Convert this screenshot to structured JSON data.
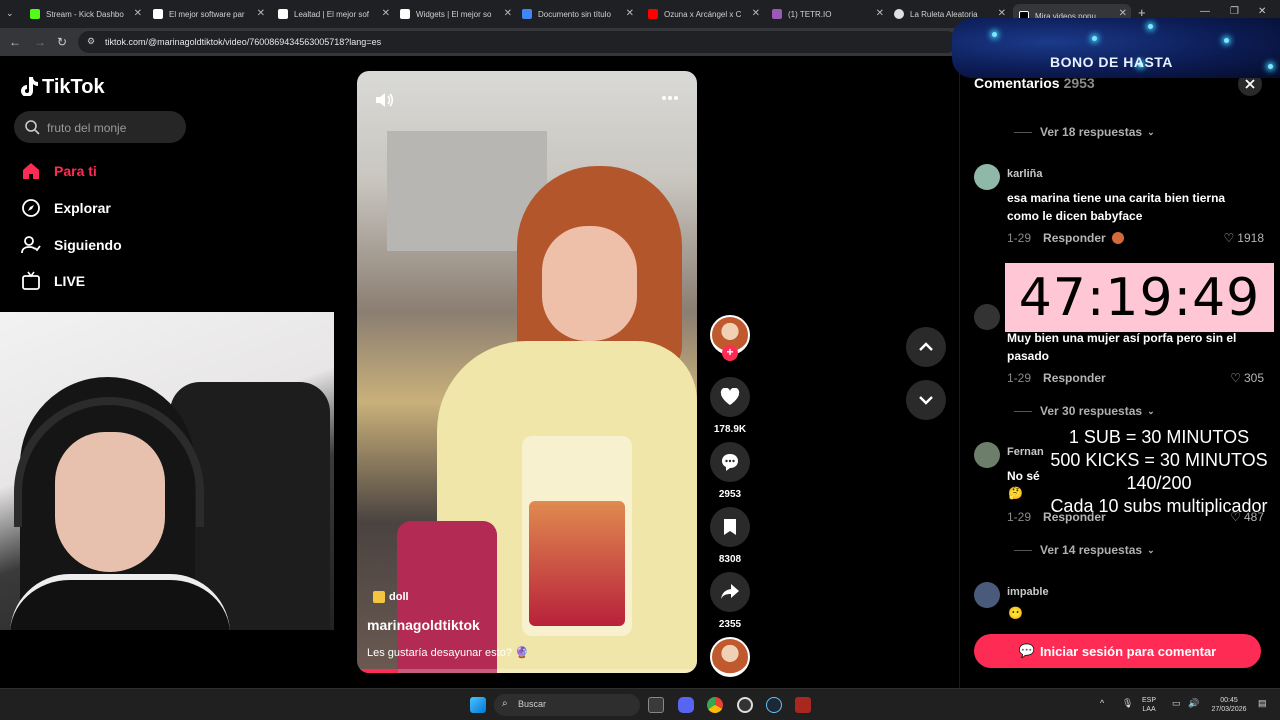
{
  "browser": {
    "tabs": [
      {
        "title": "Stream - Kick Dashbo",
        "color": "#53fc18"
      },
      {
        "title": "El mejor software par",
        "color": "#ffffff"
      },
      {
        "title": "Lealtad | El mejor sof",
        "color": "#ffffff"
      },
      {
        "title": "Widgets | El mejor so",
        "color": "#ffffff"
      },
      {
        "title": "Documento sin título",
        "color": "#4285f4"
      },
      {
        "title": "Ozuna x Arcángel x C",
        "color": "#ff0000"
      },
      {
        "title": "(1) TETR.IO",
        "color": "#9b59b6"
      },
      {
        "title": "La Ruleta Aleatoria",
        "color": "#e0e0e0"
      },
      {
        "title": "Mira videos popu",
        "color": "#ffffff"
      }
    ],
    "url": "tiktok.com/@marinagoldtiktok/video/7600869434563005718?lang=es"
  },
  "sidebar": {
    "logo": "TikTok",
    "search_placeholder": "fruto del monje",
    "nav": [
      {
        "label": "Para ti",
        "icon": "home-icon",
        "active": true
      },
      {
        "label": "Explorar",
        "icon": "compass-icon",
        "active": false
      },
      {
        "label": "Siguiendo",
        "icon": "user-follow-icon",
        "active": false
      },
      {
        "label": "LIVE",
        "icon": "live-tv-icon",
        "active": false
      }
    ]
  },
  "video": {
    "music": "doll",
    "author": "marinagoldtiktok",
    "caption": "Les gustaría desayunar esto? 🔮",
    "progress_fraction": 0.12
  },
  "actions": {
    "likes": "178.9K",
    "comments": "2953",
    "saves": "8308",
    "shares": "2355"
  },
  "comments": {
    "title": "Comentarios",
    "count": "2953",
    "items": [
      {
        "type": "replies",
        "label": "Ver 18 respuestas"
      },
      {
        "type": "comment",
        "user": "karliña",
        "text": "esa marina tiene una carita bien tierna como le dicen babyface",
        "date": "1-29",
        "reply": "Responder",
        "likes": "1918"
      },
      {
        "type": "comment",
        "user": "",
        "text": "Muy bien una mujer así porfa pero sin el pasado",
        "date": "1-29",
        "reply": "Responder",
        "likes": "305"
      },
      {
        "type": "replies",
        "label": "Ver 30 respuestas"
      },
      {
        "type": "comment",
        "user": "Fernan",
        "text": "No sé",
        "date": "1-29",
        "reply": "Responder",
        "likes": "487"
      },
      {
        "type": "replies",
        "label": "Ver 14 respuestas"
      },
      {
        "type": "comment",
        "user": "impable",
        "text": "",
        "date": "",
        "reply": "",
        "likes": ""
      }
    ],
    "login_button": "Iniciar sesión para comentar"
  },
  "overlay": {
    "bonus_text": "BONO DE HASTA",
    "timer": "47:19:49",
    "rules": [
      "1 SUB     = 30 MINUTOS",
      "500 KICKS = 30 MINUTOS",
      "140/200",
      "Cada 10 subs multiplicador"
    ]
  },
  "taskbar": {
    "search_label": "Buscar",
    "lang": "ESP",
    "lang_sub": "LAA",
    "time": "00:45",
    "date": "27/03/2026"
  }
}
